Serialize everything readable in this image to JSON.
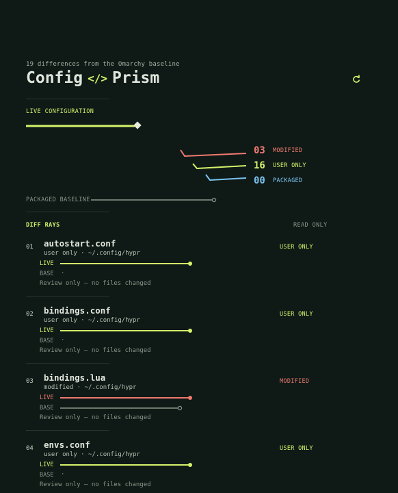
{
  "header": {
    "subtitle": "19 differences from the Omarchy baseline",
    "title_left": "Config",
    "title_icon": "</>",
    "title_right": "Prism",
    "refresh_icon": "refresh-icon"
  },
  "live": {
    "label": "LIVE CONFIGURATION",
    "level": 0.95
  },
  "stats": [
    {
      "value": "03",
      "label": "MODIFIED",
      "color": "#f07a6e"
    },
    {
      "value": "16",
      "label": "USER ONLY",
      "color": "#d6f36a"
    },
    {
      "value": "00",
      "label": "PACKAGED",
      "color": "#7ac3f0"
    }
  ],
  "baseline": {
    "label": "PACKAGED BASELINE"
  },
  "rays": {
    "label": "DIFF RAYS",
    "mode": "READ ONLY",
    "items": [
      {
        "num": "01",
        "name": "autostart.conf",
        "meta": "user only · ~/.config/hypr",
        "status": "USER ONLY",
        "status_color": "#d6f36a",
        "live_label": "LIVE",
        "base_label": "BASE",
        "base_value": "·",
        "note": "Review only — no files changed"
      },
      {
        "num": "02",
        "name": "bindings.conf",
        "meta": "user only · ~/.config/hypr",
        "status": "USER ONLY",
        "status_color": "#d6f36a",
        "live_label": "LIVE",
        "base_label": "BASE",
        "base_value": "·",
        "note": "Review only — no files changed"
      },
      {
        "num": "03",
        "name": "bindings.lua",
        "meta": "modified · ~/.config/hypr",
        "status": "MODIFIED",
        "status_color": "#f07a6e",
        "live_label": "LIVE",
        "base_label": "BASE",
        "base_value": "",
        "note": "Review only — no files changed"
      },
      {
        "num": "04",
        "name": "envs.conf",
        "meta": "user only · ~/.config/hypr",
        "status": "USER ONLY",
        "status_color": "#d6f36a",
        "live_label": "LIVE",
        "base_label": "BASE",
        "base_value": "·",
        "note": "Review only — no files changed"
      }
    ]
  },
  "colors": {
    "background": "#0f1a17",
    "accent": "#d6f36a",
    "modified": "#f07a6e",
    "packaged": "#7ac3f0",
    "baseline_line": "#8d968a"
  }
}
